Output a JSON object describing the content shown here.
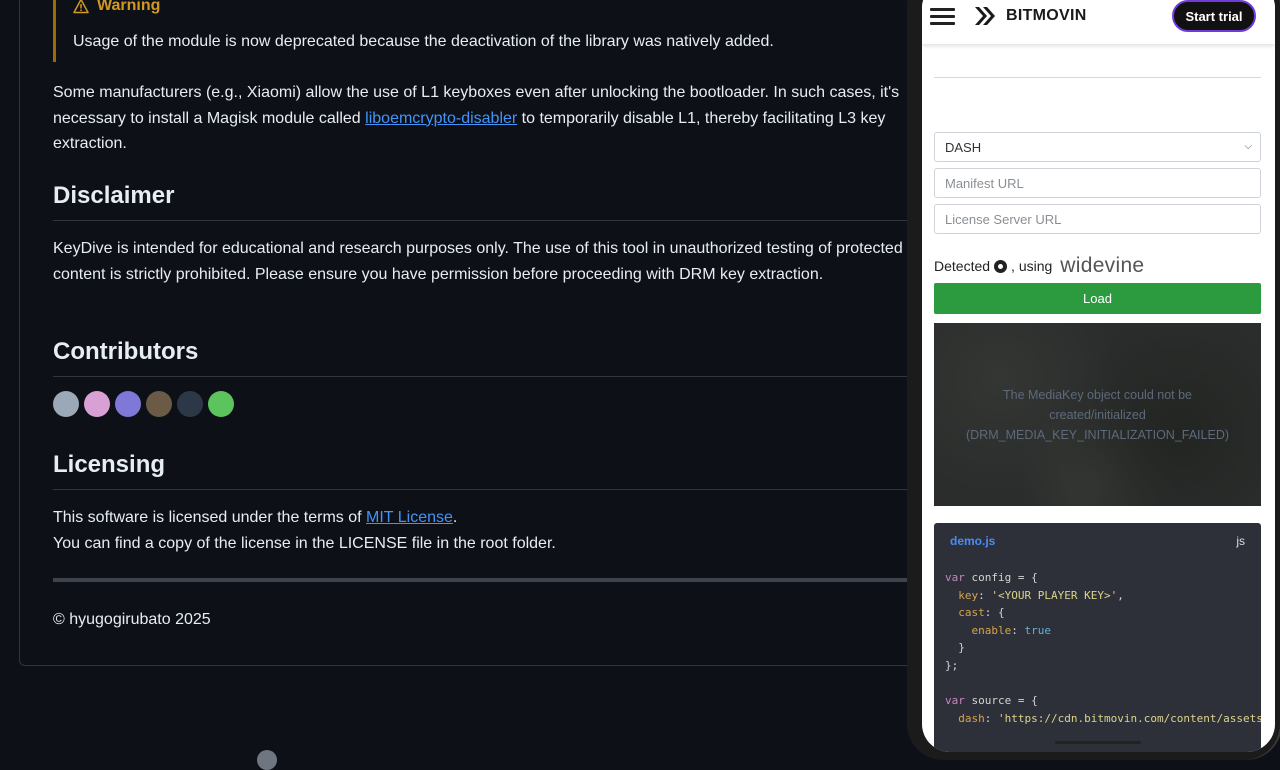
{
  "readme": {
    "warning": {
      "title": "Warning",
      "text": "Usage of the module is now deprecated because the deactivation of the library was natively added."
    },
    "para1_before": "Some manufacturers (e.g., Xiaomi) allow the use of L1 keyboxes even after unlocking the bootloader. In such cases, it's necessary to install a Magisk module called ",
    "para1_link": "liboemcrypto-disabler",
    "para1_after": " to temporarily disable L1, thereby facilitating L3 key extraction.",
    "disclaimer_heading": "Disclaimer",
    "disclaimer_text": "KeyDive is intended for educational and research purposes only. The use of this tool in unauthorized testing of protected content is strictly prohibited. Please ensure you have permission before proceeding with DRM key extraction.",
    "contributors_heading": "Contributors",
    "contributors": [
      {
        "color": "#9aa8b8"
      },
      {
        "color": "#d9a0d6"
      },
      {
        "color": "#7f78d8"
      },
      {
        "color": "#6b5a45"
      },
      {
        "color": "#2c3848"
      },
      {
        "color": "#5cc45c"
      }
    ],
    "licensing_heading": "Licensing",
    "licensing_before": "This software is licensed under the terms of ",
    "licensing_link": "MIT License",
    "licensing_after": ".",
    "licensing_line2": "You can find a copy of the license in the LICENSE file in the root folder.",
    "footer": "© hyugogirubato 2025"
  },
  "phone": {
    "brand": "BITMOVIN",
    "start_trial": "Start trial",
    "stream_type": "DASH",
    "manifest_placeholder": "Manifest URL",
    "license_placeholder": "License Server URL",
    "detected_prefix": "Detected",
    "detected_using": ", using",
    "drm_name": "widevine",
    "load_label": "Load",
    "player_error": "The MediaKey object could not be created/initialized (DRM_MEDIA_KEY_INITIALIZATION_FAILED)",
    "code_file": "demo.js",
    "code_lang": "js",
    "code": {
      "kw_var": "var",
      "config_decl": " config = {",
      "key_prop": "key",
      "key_value": "'<YOUR PLAYER KEY>'",
      "cast_prop": "cast",
      "enable_prop": "enable",
      "enable_value": "true",
      "source_decl": " source = {",
      "dash_prop": "dash",
      "dash_value": "'https://cdn.bitmovin.com/content/assets"
    }
  }
}
